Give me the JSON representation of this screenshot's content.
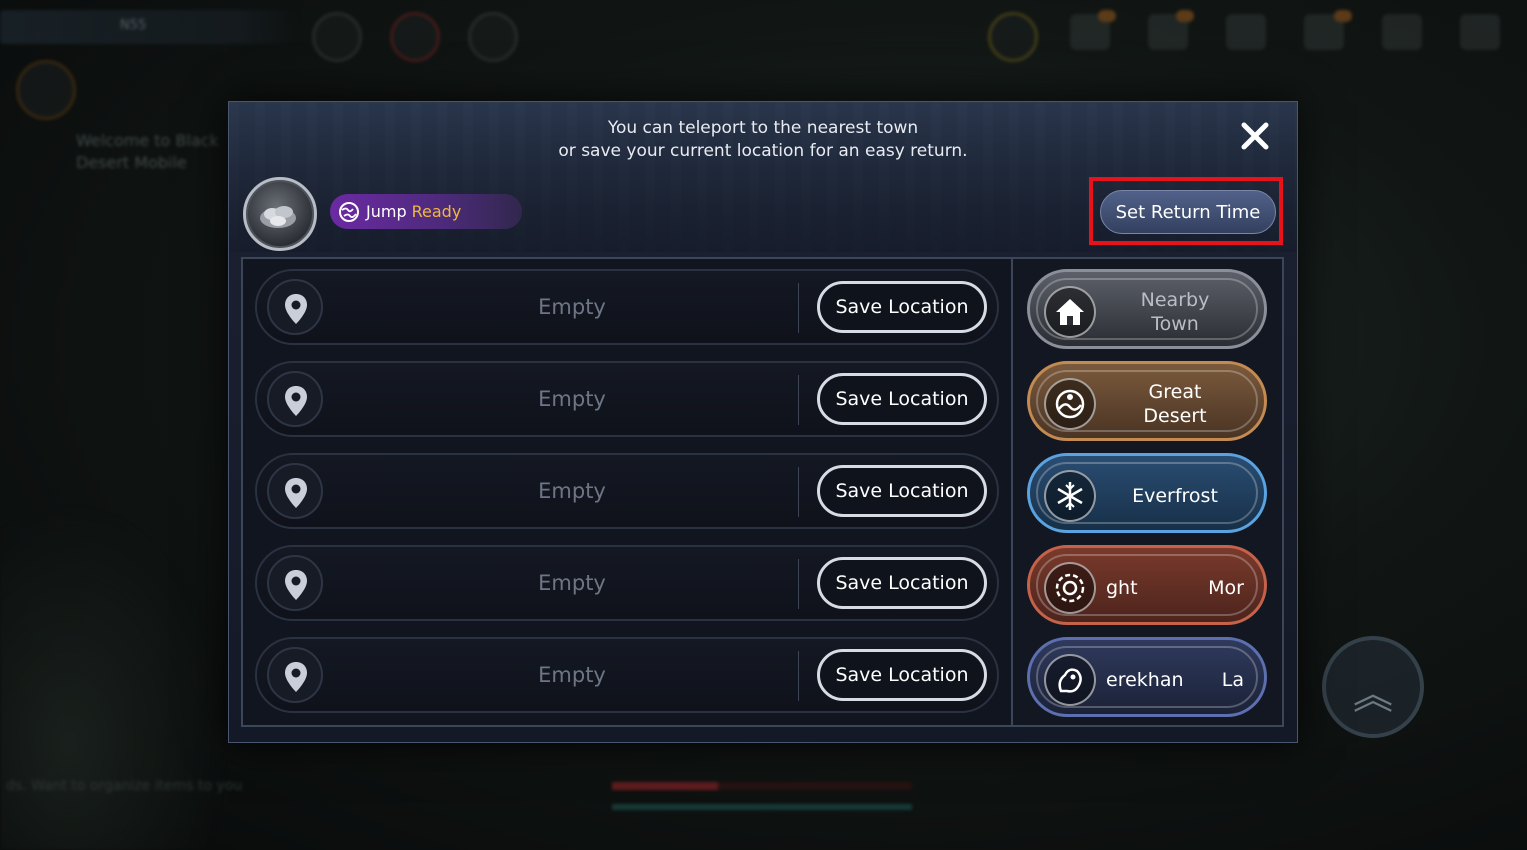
{
  "background": {
    "top_bar_text": "N55",
    "chat_lines": [
      "Welcome to Black",
      "Desert Mobile"
    ],
    "bottom_text": "ds. Want to organize items to you"
  },
  "dialog": {
    "notice_line1": "You can teleport to the nearest town",
    "notice_line2": "or save your current location for an easy return.",
    "close_icon": "close-icon",
    "jump_label": "Jump",
    "jump_status": "Ready",
    "set_return_time_label": "Set Return Time",
    "highlight_color": "#e8121a"
  },
  "slots": [
    {
      "label": "Empty",
      "button": "Save Location"
    },
    {
      "label": "Empty",
      "button": "Save Location"
    },
    {
      "label": "Empty",
      "button": "Save Location"
    },
    {
      "label": "Empty",
      "button": "Save Location"
    },
    {
      "label": "Empty",
      "button": "Save Location"
    }
  ],
  "destinations": [
    {
      "line1": "Nearby",
      "line2": "Town",
      "icon": "house-icon",
      "color": "#8a8f99"
    },
    {
      "line1": "Great",
      "line2": "Desert",
      "icon": "desert-emblem-icon",
      "color": "#c38a52"
    },
    {
      "label": "Everfrost",
      "icon": "snowflake-icon",
      "color": "#5aa2e0"
    },
    {
      "left": "ght",
      "right": "Mor",
      "icon": "morning-emblem-icon",
      "color": "#c4624a"
    },
    {
      "left": "erekhan",
      "right": "La",
      "icon": "dragon-emblem-icon",
      "color": "#5d6fae"
    }
  ]
}
